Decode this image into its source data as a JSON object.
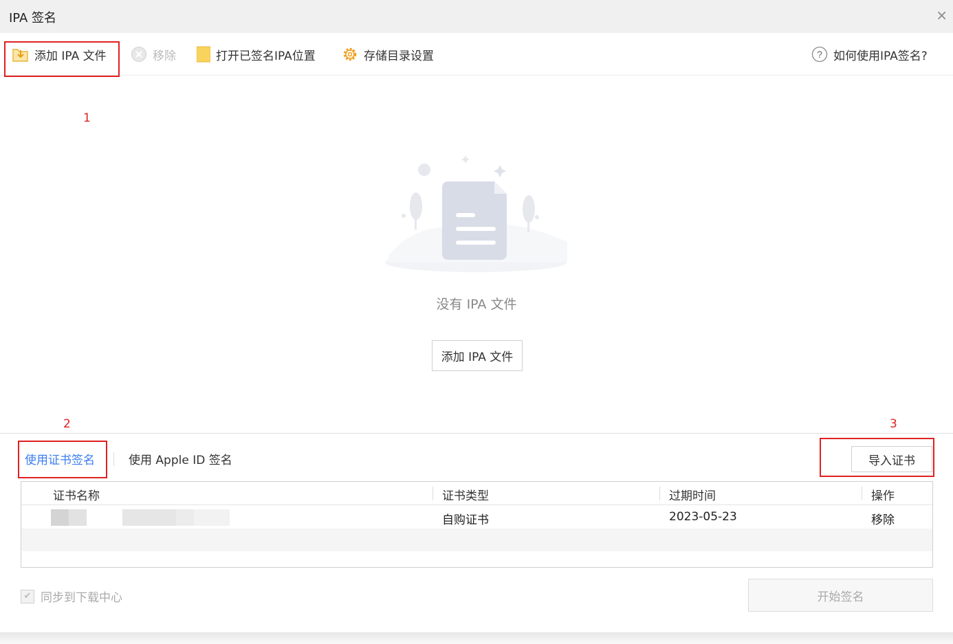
{
  "window": {
    "title": "IPA 签名",
    "close_glyph": "×"
  },
  "toolbar": {
    "add_label": "添加 IPA 文件",
    "remove_label": "移除",
    "open_label": "打开已签名IPA位置",
    "settings_label": "存储目录设置",
    "help_label": "如何使用IPA签名?"
  },
  "annotations": {
    "n1": "1",
    "n2": "2",
    "n3": "3"
  },
  "empty_state": {
    "message": "没有 IPA 文件",
    "button_label": "添加 IPA 文件"
  },
  "tabs": {
    "cert_tab": "使用证书签名",
    "appleid_tab": "使用 Apple ID 签名",
    "import_button": "导入证书"
  },
  "table": {
    "headers": {
      "name": "证书名称",
      "type": "证书类型",
      "expiry": "过期时间",
      "action": "操作"
    },
    "rows": [
      {
        "type": "自购证书",
        "expiry": "2023-05-23",
        "action": "移除"
      }
    ]
  },
  "footer": {
    "sync_label": "同步到下载中心",
    "sync_checked": true,
    "start_button": "开始签名"
  },
  "colors": {
    "accent": "#3c7ef0",
    "annotation_red": "#e02020",
    "folder_yellow": "#f5c73b",
    "gear_orange": "#f0a020"
  },
  "icons": {
    "add": "folder-download-icon",
    "remove": "circle-x-icon",
    "open": "folder-icon",
    "settings": "gear-icon",
    "help": "question-circle-icon",
    "empty": "empty-document-illustration"
  }
}
